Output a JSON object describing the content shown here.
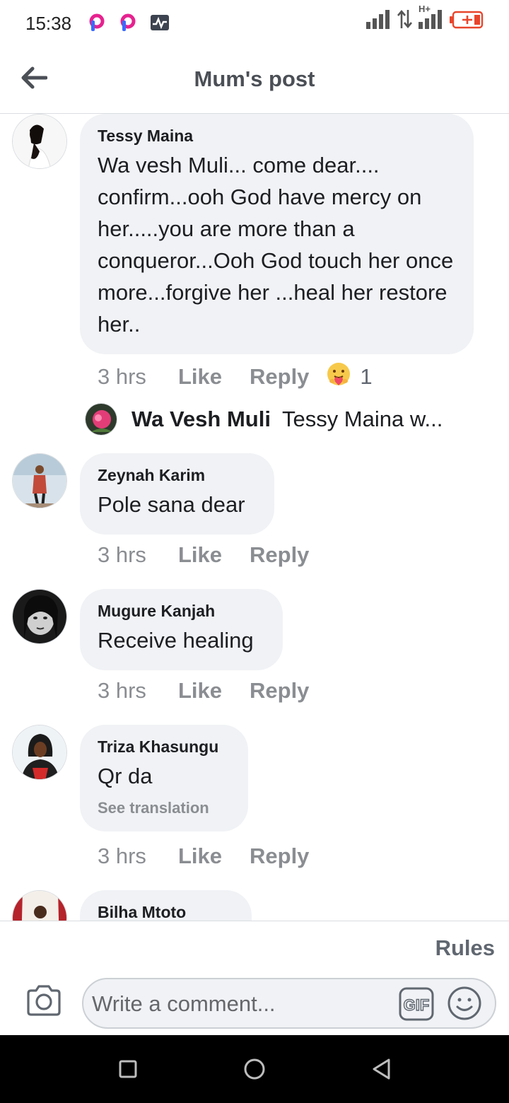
{
  "status_bar": {
    "time": "15:38",
    "icons": [
      "picsart-icon",
      "picsart-icon",
      "activity-monitor-icon",
      "signal-icon",
      "data-arrows-icon",
      "h-plus-signal-icon",
      "battery-low-icon"
    ],
    "network_label": "H+",
    "battery_color": "#e8452c"
  },
  "header": {
    "title": "Mum's post",
    "back_icon": "arrow-left-icon"
  },
  "comments": [
    {
      "author": "Tessy Maina",
      "text": "Wa vesh Muli... come dear.... confirm...ooh God have mercy on her.....you are more than a conqueror...Ooh God touch her once more...forgive her ...heal her restore her..",
      "time": "3 hrs",
      "like": "Like",
      "reply": "Reply",
      "reaction_icon": "care-emoji-icon",
      "reaction_count": "1"
    },
    {
      "author": "Zeynah Karim",
      "text": "Pole sana dear",
      "time": "3 hrs",
      "like": "Like",
      "reply": "Reply"
    },
    {
      "author": "Mugure Kanjah",
      "text": "Receive healing",
      "time": "3 hrs",
      "like": "Like",
      "reply": "Reply"
    },
    {
      "author": "Triza Khasungu",
      "text": "Qr da",
      "see_translation": "See translation",
      "time": "3 hrs",
      "like": "Like",
      "reply": "Reply"
    },
    {
      "author": "Bilha Mtoto"
    }
  ],
  "reply_preview": {
    "name": "Wa Vesh Muli",
    "snippet": "Tessy Maina w..."
  },
  "footer": {
    "rules": "Rules",
    "placeholder": "Write a comment...",
    "gif_label": "GIF",
    "camera_icon": "camera-icon",
    "emoji_icon": "smiley-icon"
  },
  "nav": {
    "icons": [
      "recent-apps-icon",
      "home-icon",
      "back-triangle-icon"
    ]
  },
  "colors": {
    "bubble": "#f0f2f5",
    "secondary_text": "#8a8d91",
    "divider": "#dadde1"
  }
}
